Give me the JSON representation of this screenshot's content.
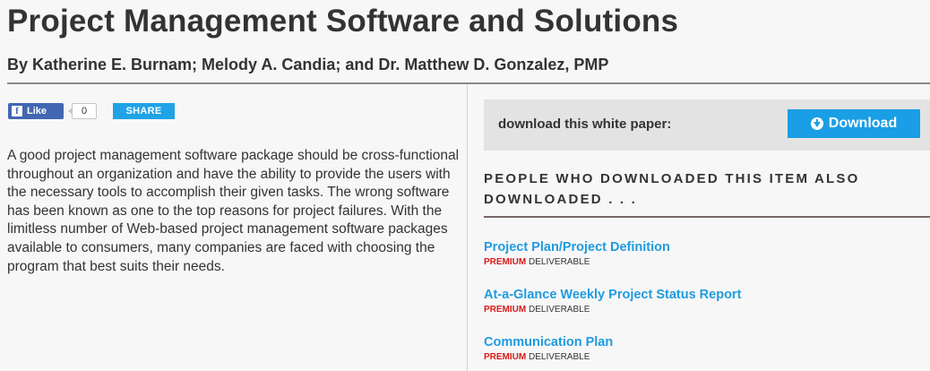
{
  "article": {
    "title": "Project Management Software and Solutions",
    "byline": "By Katherine E. Burnam; Melody A. Candia; and Dr. Matthew D. Gonzalez, PMP",
    "body": "A good project management software package should be cross-functional throughout an organization and have the ability to provide the users with the necessary tools to accomplish their given tasks. The wrong software has been known as one to the top reasons for project failures. With the limitless number of Web-based project management software packages available to consumers, many companies are faced with choosing the program that best suits their needs."
  },
  "social": {
    "like_label": "Like",
    "like_count": "0",
    "share_label": "SHARE"
  },
  "download": {
    "label": "download this white paper:",
    "button_label": "Download"
  },
  "related": {
    "heading": "PEOPLE WHO DOWNLOADED THIS ITEM ALSO DOWNLOADED . . .",
    "items": [
      {
        "title": "Project Plan/Project Definition",
        "tag": "PREMIUM",
        "type": "DELIVERABLE"
      },
      {
        "title": "At-a-Glance Weekly Project Status Report",
        "tag": "PREMIUM",
        "type": "DELIVERABLE"
      },
      {
        "title": "Communication Plan",
        "tag": "PREMIUM",
        "type": "DELIVERABLE"
      }
    ]
  },
  "colors": {
    "accent_blue": "#1a9ee5",
    "facebook_blue": "#4267b2",
    "premium_red": "#d81b1b",
    "link_blue": "#1f9be0"
  }
}
